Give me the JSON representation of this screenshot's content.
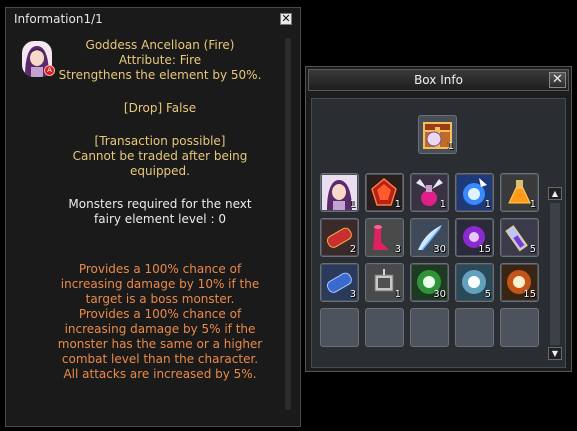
{
  "info": {
    "title": "Information1/1",
    "close_label": "✕",
    "badge_label": "A",
    "name_line": "Goddess Ancelloan (Fire)",
    "attribute_line": "Attribute: Fire",
    "strength_line": "Strengthens the element by 50%.",
    "drop_line": "[Drop] False",
    "transaction_header": "[Transaction possible]",
    "transaction_lines": [
      "Cannot be traded after being",
      "equipped."
    ],
    "monsters_lines": [
      "Monsters required for the next",
      "fairy element level : 0"
    ],
    "effect_lines": [
      "Provides a 100% chance of",
      "increasing damage by 10% if the",
      "target is a boss monster.",
      "Provides a 100% chance of",
      "increasing damage by 5% if the",
      "monster has the same or a higher",
      "combat level than the character.",
      "All attacks are increased by 5%."
    ]
  },
  "box": {
    "title": "Box Info",
    "close_label": "✕",
    "header_item": {
      "icon": "treasure-box-icon",
      "qty": "1"
    },
    "scroll_up": "▲",
    "scroll_down": "▼",
    "items": [
      {
        "icon": "fairy-portrait-icon",
        "qty": "1"
      },
      {
        "icon": "red-gem-icon",
        "qty": "1"
      },
      {
        "icon": "wing-potion-icon",
        "qty": "1"
      },
      {
        "icon": "blue-orb-icon",
        "qty": "1"
      },
      {
        "icon": "orange-potion-icon",
        "qty": "1"
      },
      {
        "icon": "red-scroll-icon",
        "qty": "2"
      },
      {
        "icon": "pink-horn-icon",
        "qty": "3"
      },
      {
        "icon": "blue-feather-icon",
        "qty": "30"
      },
      {
        "icon": "purple-orb-icon",
        "qty": "15"
      },
      {
        "icon": "crystal-vial-icon",
        "qty": "5"
      },
      {
        "icon": "blue-scroll-icon",
        "qty": "3"
      },
      {
        "icon": "silver-lantern-icon",
        "qty": "1"
      },
      {
        "icon": "green-spark-icon",
        "qty": "30"
      },
      {
        "icon": "white-spark-icon",
        "qty": "5"
      },
      {
        "icon": "fire-spark-icon",
        "qty": "15"
      },
      {
        "icon": "empty-slot",
        "qty": ""
      },
      {
        "icon": "empty-slot",
        "qty": ""
      },
      {
        "icon": "empty-slot",
        "qty": ""
      },
      {
        "icon": "empty-slot",
        "qty": ""
      },
      {
        "icon": "empty-slot",
        "qty": ""
      }
    ]
  }
}
